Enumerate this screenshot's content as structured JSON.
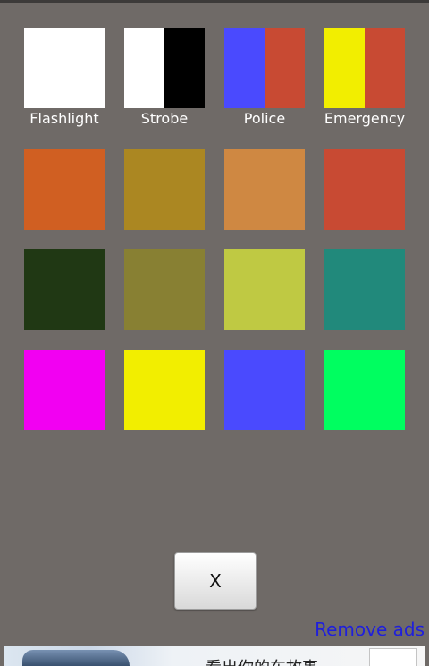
{
  "modes": [
    {
      "label": "Flashlight",
      "colors": [
        "#ffffff"
      ]
    },
    {
      "label": "Strobe",
      "colors": [
        "#ffffff",
        "#000000"
      ]
    },
    {
      "label": "Police",
      "colors": [
        "#4a4afe",
        "#c84a33"
      ]
    },
    {
      "label": "Emergency",
      "colors": [
        "#f2ee00",
        "#c84a33"
      ]
    }
  ],
  "color_rows": [
    [
      "#d05f22",
      "#ab8722",
      "#cf8842",
      "#c84a33"
    ],
    [
      "#203814",
      "#888033",
      "#bfc943",
      "#21897b"
    ],
    [
      "#f200f2",
      "#f2ee00",
      "#4a4afe",
      "#00fe60"
    ]
  ],
  "close_button": {
    "label": "X"
  },
  "remove_ads": {
    "label": "Remove ads"
  },
  "ad": {
    "text": "看出你的车故事"
  }
}
